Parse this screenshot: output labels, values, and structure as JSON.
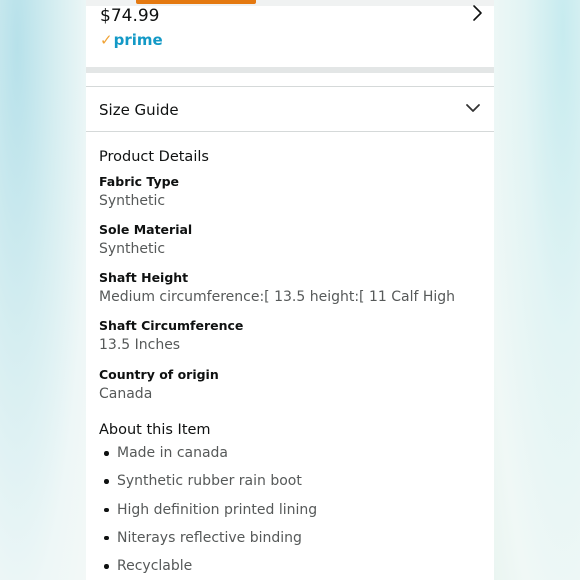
{
  "product": {
    "price": "$74.99",
    "prime": {
      "check": "✓",
      "label": "prime"
    },
    "image_carousel_progress": 0.3
  },
  "size_guide": {
    "label": "Size Guide"
  },
  "product_details": {
    "title": "Product Details",
    "items": [
      {
        "label": "Fabric Type",
        "value": "Synthetic"
      },
      {
        "label": "Sole Material",
        "value": "Synthetic"
      },
      {
        "label": "Shaft Height",
        "value": "Medium circumference:[ 13.5 height:[ 11 Calf High"
      },
      {
        "label": "Shaft Circumference",
        "value": "13.5 Inches"
      },
      {
        "label": "Country of origin",
        "value": "Canada"
      }
    ]
  },
  "about": {
    "title": "About this Item",
    "bullets": [
      "Made in canada",
      "Synthetic rubber rain boot",
      "High definition printed lining",
      "Niterays reflective binding",
      "Recyclable"
    ]
  },
  "icons": {
    "next": "chevron-right-icon",
    "expand": "chevron-down-icon"
  },
  "colors": {
    "progress": "#e47911",
    "prime_blue": "#1399c6",
    "prime_check": "#f0a336",
    "text_primary": "#0f1111",
    "text_secondary": "#565959"
  }
}
